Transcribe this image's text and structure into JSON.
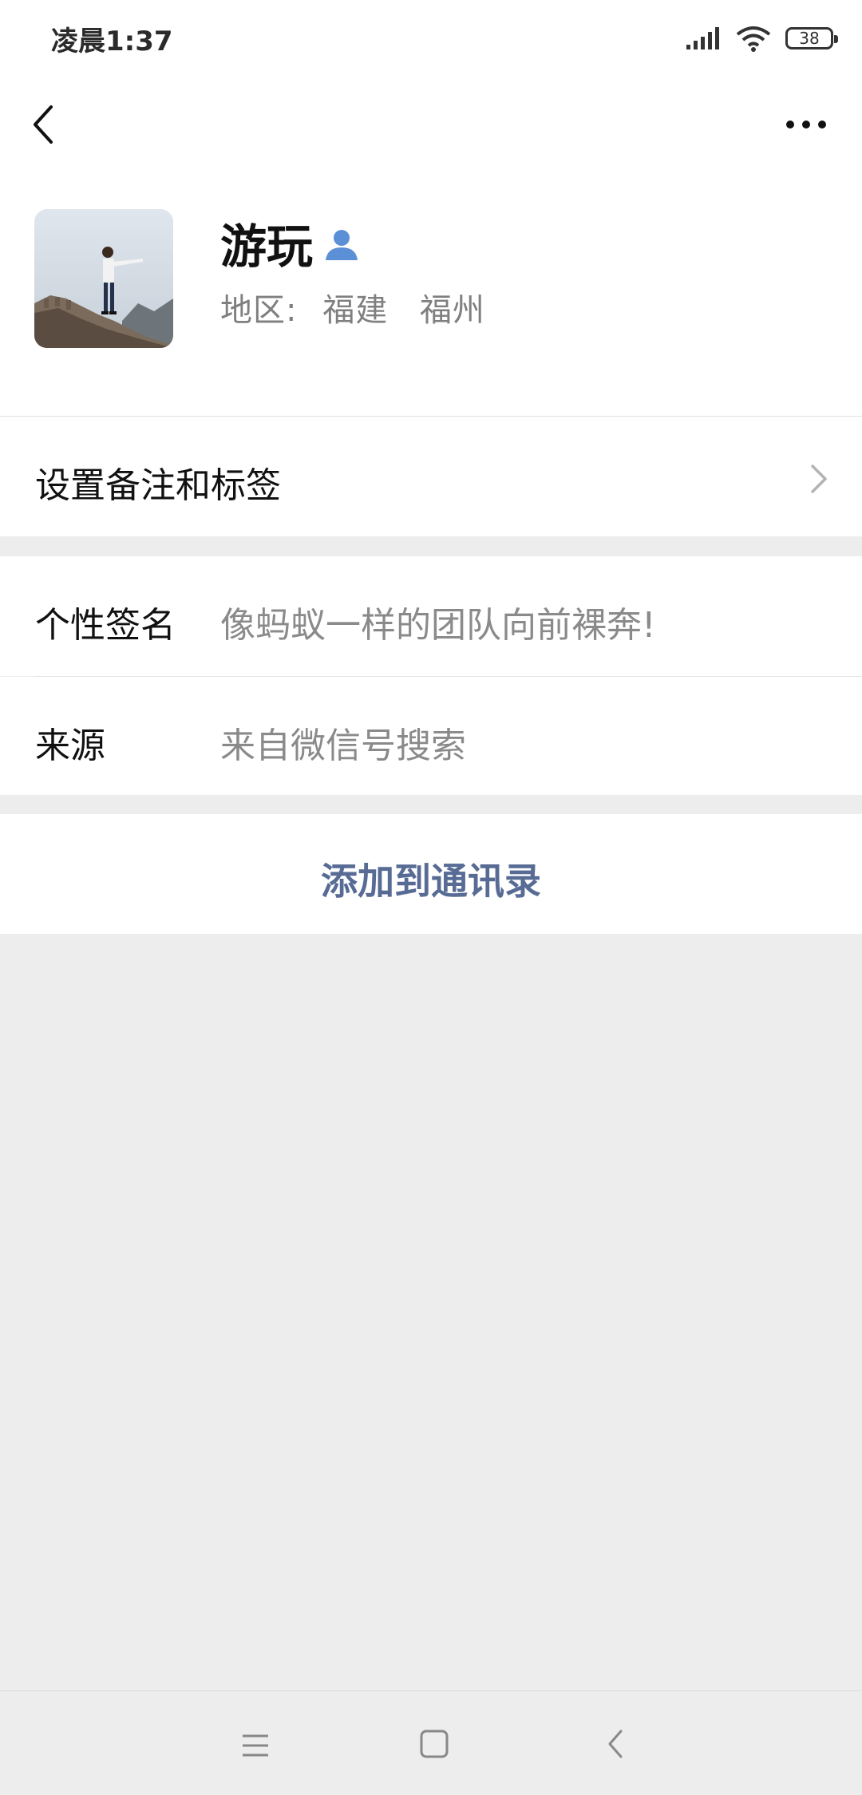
{
  "status_bar": {
    "time": "凌晨1:37",
    "battery": "38"
  },
  "profile": {
    "name": "游玩",
    "region_label": "地区:",
    "region_province": "福建",
    "region_city": "福州"
  },
  "rows": {
    "settings_label": "设置备注和标签",
    "signature_label": "个性签名",
    "signature_value": "像蚂蚁一样的团队向前裸奔!",
    "source_label": "来源",
    "source_value": "来自微信号搜索"
  },
  "actions": {
    "add_to_contacts": "添加到通讯录"
  },
  "colors": {
    "link_blue": "#576b95",
    "contact_icon": "#5b8fd6",
    "background": "#ededed"
  }
}
